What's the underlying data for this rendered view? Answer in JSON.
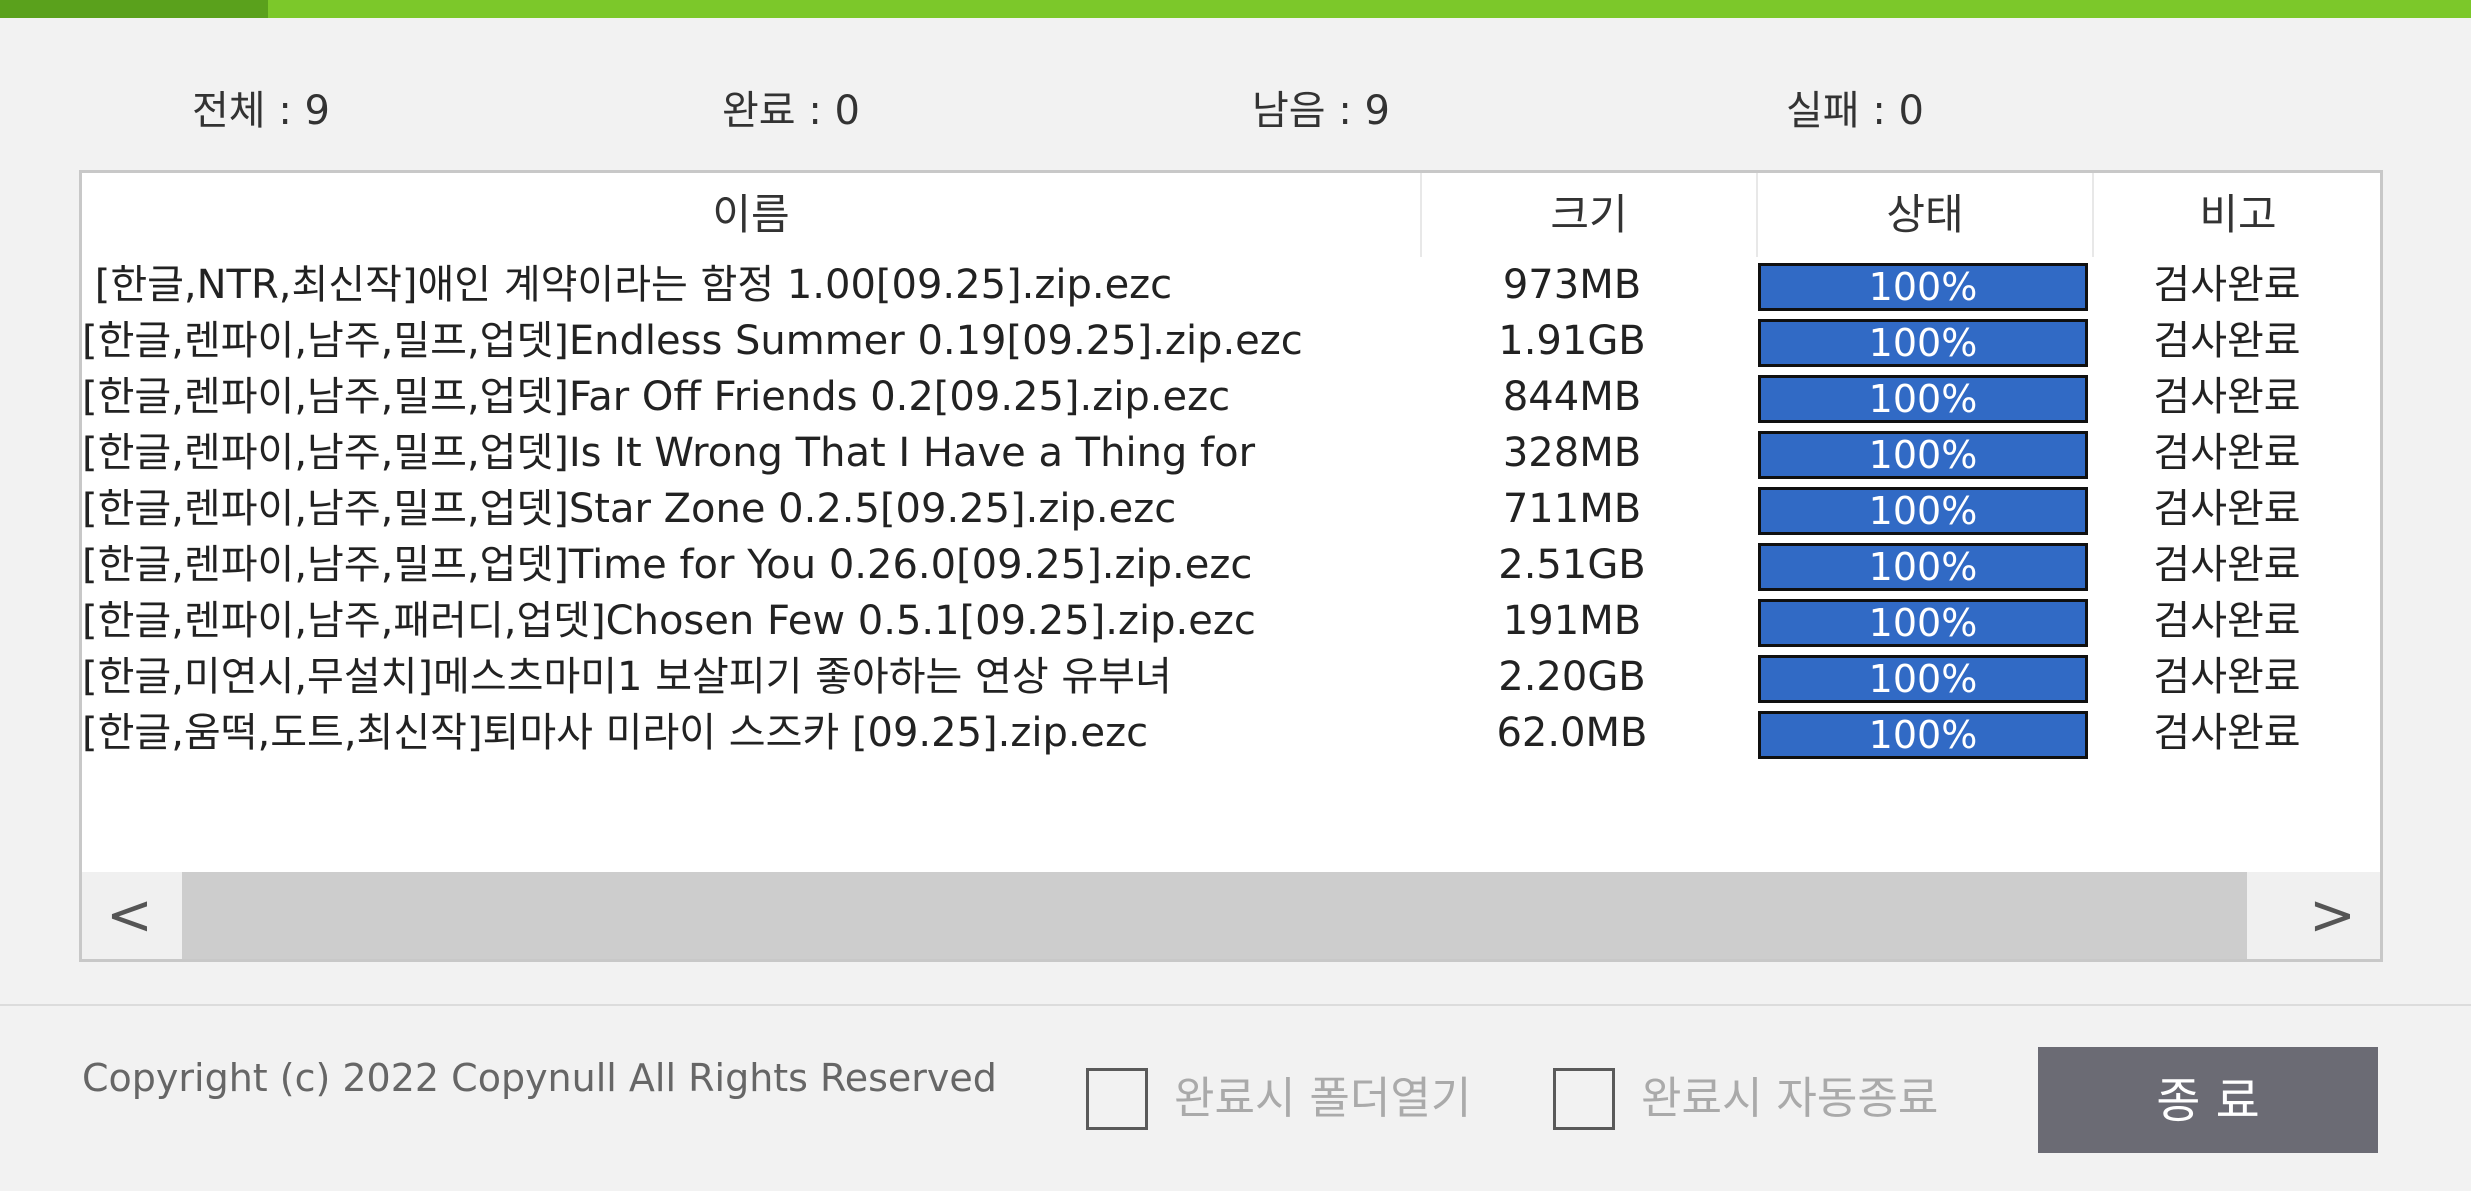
{
  "stats": {
    "total": "전체 : 9",
    "done": "완료 : 0",
    "remaining": "남음 : 9",
    "failed": "실패 : 0"
  },
  "table": {
    "headers": {
      "name": "이름",
      "size": "크기",
      "status": "상태",
      "remark": "비고"
    },
    "rows": [
      {
        "name": " [한글,NTR,최신작]애인 계약이라는 함정 1.00[09.25].zip.ezc",
        "size": "973MB",
        "progress": 100,
        "status_text": "100%",
        "remark": "검사완료"
      },
      {
        "name": "[한글,렌파이,남주,밀프,업뎃]Endless Summer 0.19[09.25].zip.ezc",
        "size": "1.91GB",
        "progress": 100,
        "status_text": "100%",
        "remark": "검사완료"
      },
      {
        "name": "[한글,렌파이,남주,밀프,업뎃]Far Off Friends 0.2[09.25].zip.ezc",
        "size": "844MB",
        "progress": 100,
        "status_text": "100%",
        "remark": "검사완료"
      },
      {
        "name": "[한글,렌파이,남주,밀프,업뎃]Is It Wrong That I Have a Thing for",
        "size": "328MB",
        "progress": 100,
        "status_text": "100%",
        "remark": "검사완료"
      },
      {
        "name": "[한글,렌파이,남주,밀프,업뎃]Star Zone 0.2.5[09.25].zip.ezc",
        "size": "711MB",
        "progress": 100,
        "status_text": "100%",
        "remark": "검사완료"
      },
      {
        "name": "[한글,렌파이,남주,밀프,업뎃]Time for You 0.26.0[09.25].zip.ezc",
        "size": "2.51GB",
        "progress": 100,
        "status_text": "100%",
        "remark": "검사완료"
      },
      {
        "name": "[한글,렌파이,남주,패러디,업뎃]Chosen Few 0.5.1[09.25].zip.ezc",
        "size": "191MB",
        "progress": 100,
        "status_text": "100%",
        "remark": "검사완료"
      },
      {
        "name": "[한글,미연시,무설치]메스츠마미1 보살피기 좋아하는 연상 유부녀",
        "size": "2.20GB",
        "progress": 100,
        "status_text": "100%",
        "remark": "검사완료"
      },
      {
        "name": "[한글,움떡,도트,최신작]퇴마사 미라이 스즈카 [09.25].zip.ezc",
        "size": "62.0MB",
        "progress": 100,
        "status_text": "100%",
        "remark": "검사완료"
      }
    ]
  },
  "scrollbar": {
    "left_arrow": "<",
    "right_arrow": ">"
  },
  "footer": {
    "copyright": "Copyright (c) 2022 Copynull All Rights Reserved",
    "open_folder_label": "완료시 폴더열기",
    "auto_exit_label": "완료시 자동종료",
    "exit_label": "종 료"
  },
  "colors": {
    "accent_bar": "#7cc82a",
    "progress_fill": "#316ac5",
    "exit_button": "#6b6b74"
  }
}
